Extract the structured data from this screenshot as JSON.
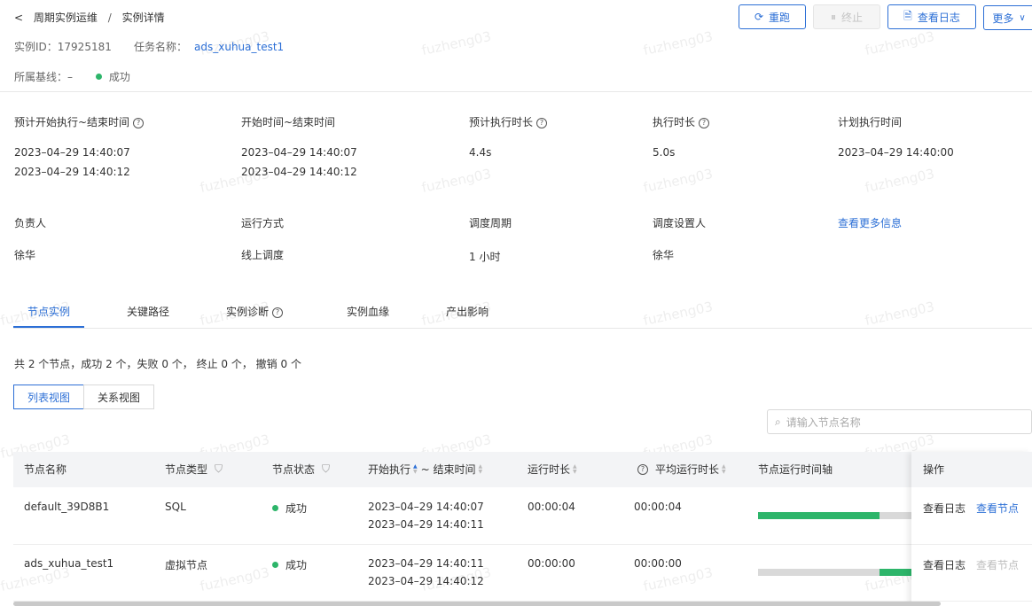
{
  "breadcrumb": {
    "parent": "周期实例运维",
    "separator": "/",
    "current": "实例详情"
  },
  "actions": {
    "rerun": "重跑",
    "terminate": "终止",
    "view_log": "查看日志",
    "more": "更多"
  },
  "instance": {
    "id_label": "实例ID：",
    "id_value": "17925181",
    "task_label": "任务名称：",
    "task_value": "ads_xuhua_test1",
    "baseline_label": "所属基线：",
    "baseline_value": "–",
    "status": "成功"
  },
  "info_row1": [
    {
      "label": "预计开始执行~结束时间",
      "help": true,
      "lines": [
        "2023–04–29 14:40:07",
        "2023–04–29 14:40:12"
      ]
    },
    {
      "label": "开始时间~结束时间",
      "help": false,
      "lines": [
        "2023–04–29 14:40:07",
        "2023–04–29 14:40:12"
      ]
    },
    {
      "label": "预计执行时长",
      "help": true,
      "lines": [
        "4.4s"
      ]
    },
    {
      "label": "执行时长",
      "help": true,
      "lines": [
        "5.0s"
      ]
    },
    {
      "label": "计划执行时间",
      "help": false,
      "lines": [
        "2023–04–29 14:40:00"
      ]
    }
  ],
  "info_row2": [
    {
      "label": "负责人",
      "value": "徐华"
    },
    {
      "label": "运行方式",
      "value": "线上调度"
    },
    {
      "label": "调度周期",
      "value": "1 小时"
    },
    {
      "label": "调度设置人",
      "value": "徐华"
    }
  ],
  "more_info_link": "查看更多信息",
  "tabs": [
    "节点实例",
    "关键路径",
    "实例诊断",
    "实例血缘",
    "产出影响"
  ],
  "summary": "共 2 个节点，成功 2 个，失败 0 个， 终止 0 个， 撤销 0 个",
  "views": [
    "列表视图",
    "关系视图"
  ],
  "search": {
    "placeholder": "请输入节点名称"
  },
  "table": {
    "headers": {
      "name": "节点名称",
      "type": "节点类型",
      "status": "节点状态",
      "start": "开始执行",
      "end": "~ 结束时间",
      "duration": "运行时长",
      "avg": "平均运行时长",
      "timeline": "节点运行时间轴",
      "ops": "操作"
    },
    "rows": [
      {
        "name": "default_39D8B1",
        "type": "SQL",
        "status": "成功",
        "start": "2023–04–29 14:40:07",
        "end": "2023–04–29 14:40:11",
        "duration": "00:00:04",
        "avg": "00:00:04",
        "timeline_start": 0.0,
        "timeline_end": 0.79,
        "op_log": "查看日志",
        "op_node": "查看节点",
        "op_node_enabled": true
      },
      {
        "name": "ads_xuhua_test1",
        "type": "虚拟节点",
        "status": "成功",
        "start": "2023–04–29 14:40:11",
        "end": "2023–04–29 14:40:12",
        "duration": "00:00:00",
        "avg": "00:00:00",
        "timeline_start": 0.79,
        "timeline_end": 1.0,
        "op_log": "查看日志",
        "op_node": "查看节点",
        "op_node_enabled": false
      }
    ]
  },
  "watermark": "fuzheng03",
  "colors": {
    "primary": "#2c6fd6",
    "success": "#2db56a",
    "disabled": "#c4c4c4"
  }
}
